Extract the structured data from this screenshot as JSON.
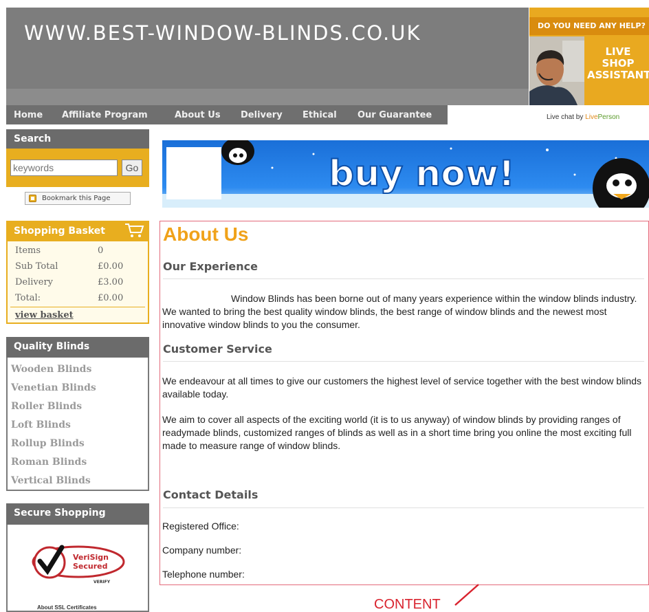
{
  "header": {
    "site_url": "WWW.BEST-WINDOW-BLINDS.CO.UK"
  },
  "nav": {
    "items": [
      "Home",
      "Affiliate Program",
      "About Us",
      "Delivery",
      "Ethical",
      "Our Guarantee"
    ]
  },
  "live_help": {
    "question": "DO YOU NEED ANY HELP?",
    "line1": "LIVE",
    "line2": "SHOP",
    "line3": "ASSISTANT",
    "chat_prefix": "Live chat by ",
    "chat_brand_a": "Live",
    "chat_brand_b": "Person"
  },
  "search": {
    "title": "Search",
    "placeholder": "keywords",
    "button": "Go",
    "bookmark": "Bookmark this Page"
  },
  "basket": {
    "title": "Shopping Basket",
    "rows": [
      {
        "label": "Items",
        "value": "0"
      },
      {
        "label": "Sub Total",
        "value": "£0.00"
      },
      {
        "label": "Delivery",
        "value": "£3.00"
      },
      {
        "label": "Total:",
        "value": "£0.00"
      }
    ],
    "view_link": "view basket"
  },
  "quality": {
    "title": "Quality Blinds",
    "items": [
      "Wooden Blinds",
      "Venetian Blinds",
      "Roller Blinds",
      "Loft Blinds",
      "Rollup Blinds",
      "Roman Blinds",
      "Vertical Blinds"
    ]
  },
  "secure": {
    "title": "Secure Shopping",
    "verisign_line1": "VeriSign",
    "verisign_line2": "Secured",
    "verify": "VERIFY",
    "ssl": "About SSL Certificates"
  },
  "banner": {
    "text": "buy now!"
  },
  "content": {
    "title": "About Us",
    "experience_head": "Our Experience",
    "experience_text": "Window Blinds has been borne out of many years experience within the window blinds industry. We wanted to bring the best quality window blinds, the best range of window blinds and the newest most innovative window blinds to you the consumer.",
    "service_head": "Customer Service",
    "service_text1": "We endeavour at all times to give our customers the highest level of service together with the best window blinds available today.",
    "service_text2": "We aim to cover all aspects of the exciting world (it is to us anyway) of window blinds by providing ranges of readymade blinds, customized ranges of blinds as well as in a short time bring you online the most exciting full made to measure range of window blinds.",
    "contact_head": "Contact Details",
    "registered": "Registered Office:",
    "company": "Company number:",
    "telephone": "Telephone number:"
  },
  "annotation": {
    "label": "CONTENT"
  },
  "colors": {
    "accent_orange": "#e8ae1f",
    "title_orange": "#f0a21a",
    "header_gray": "#7d7d7d",
    "content_border": "#e36a7a",
    "annotation_red": "#d9232e"
  }
}
